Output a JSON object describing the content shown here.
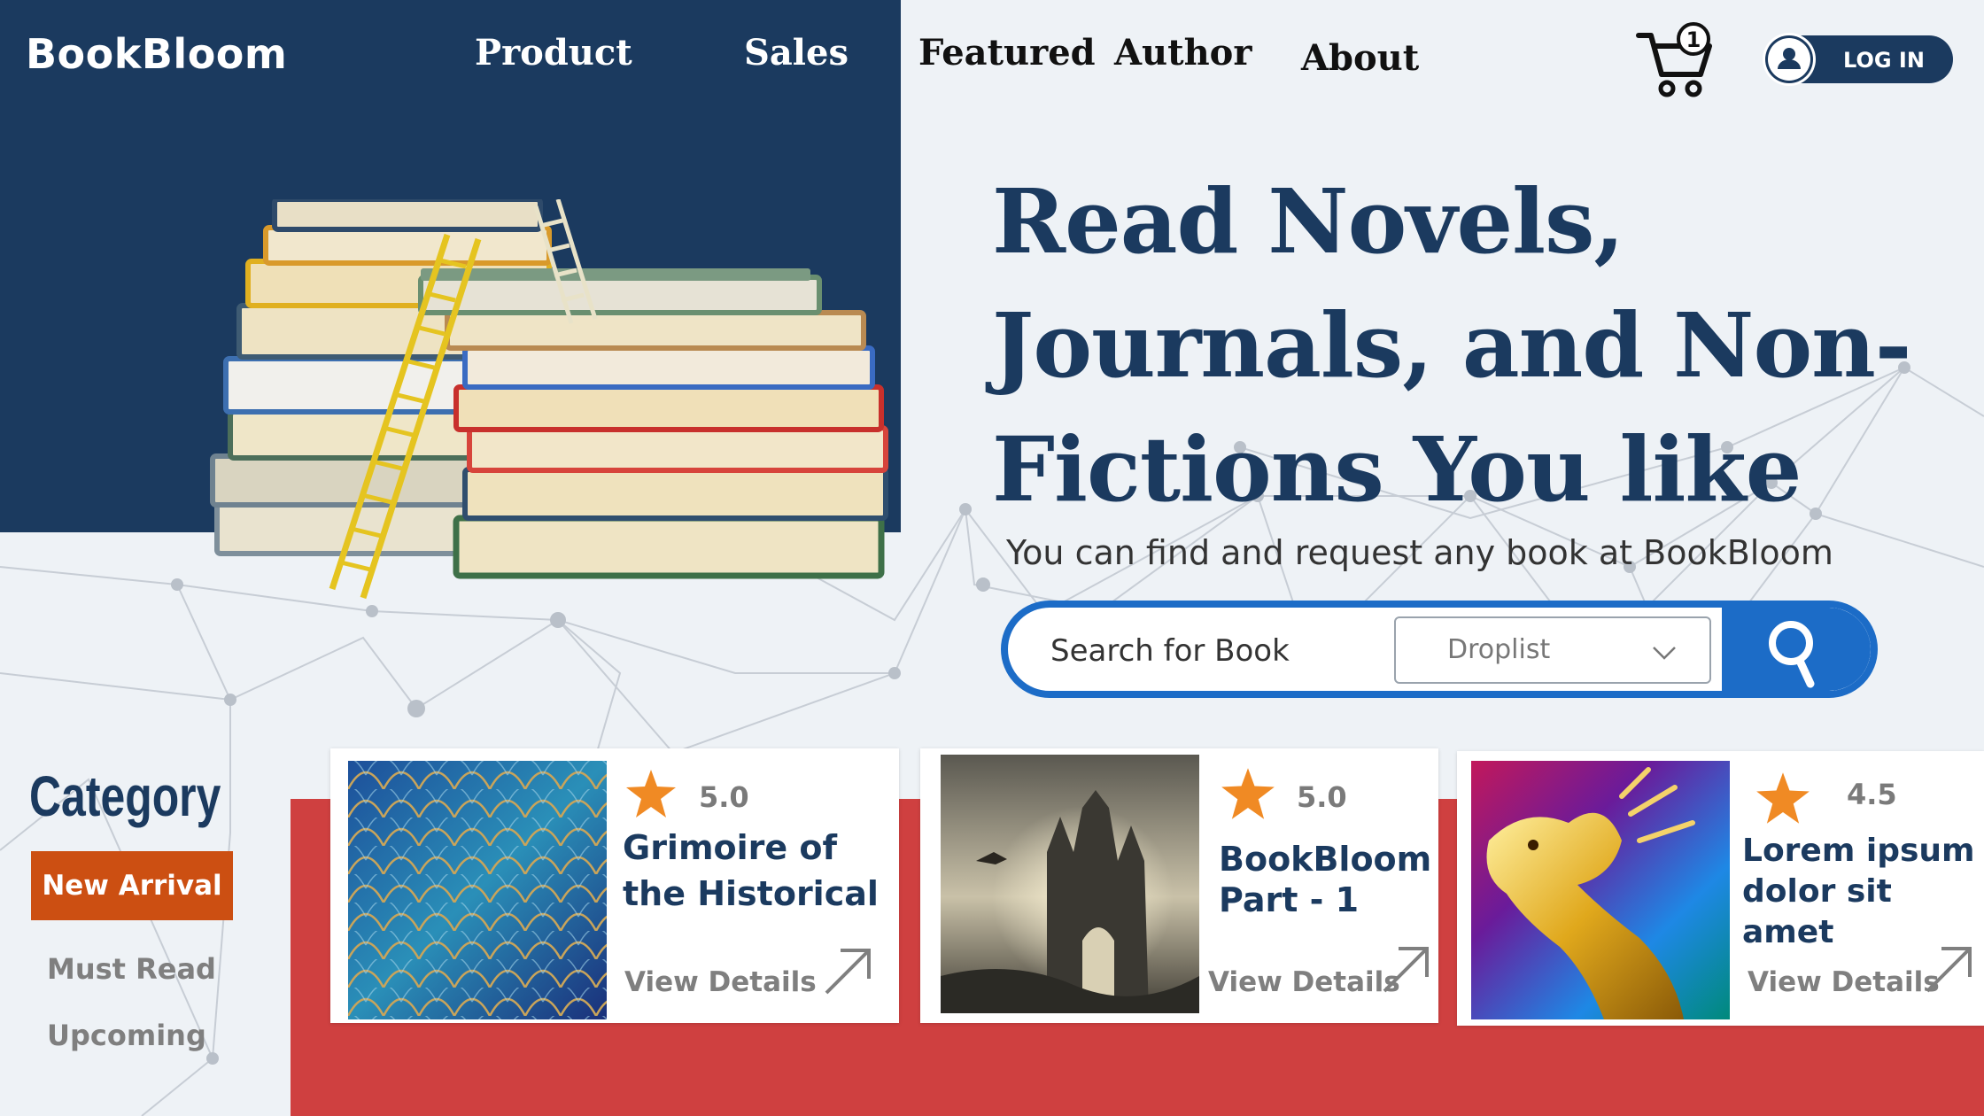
{
  "brand": {
    "name": "BookBloom"
  },
  "nav": {
    "product": "Product",
    "sales": "Sales",
    "featured": "Featured",
    "author": "Author",
    "about": "About"
  },
  "cart": {
    "count": "1",
    "icon": "cart-icon"
  },
  "login": {
    "label": "LOG IN",
    "icon": "user-icon"
  },
  "hero": {
    "headline": "Read Novels, Journals, and Non-Fictions You like",
    "tagline": "You can find and request any book at BookBloom"
  },
  "search": {
    "placeholder": "Search for Book",
    "value": "",
    "droplist_label": "Droplist",
    "button_icon": "search-icon"
  },
  "category": {
    "title": "Category",
    "items": [
      {
        "label": "New Arrival",
        "active": true
      },
      {
        "label": "Must Read",
        "active": false
      },
      {
        "label": "Upcoming",
        "active": false
      }
    ]
  },
  "books": [
    {
      "rating": "5.0",
      "title": "Grimoire of the Historical",
      "action": "View Details",
      "image": "dragon-scales"
    },
    {
      "rating": "5.0",
      "title": "BookBloom Part - 1",
      "action": "View Details",
      "image": "castle-with-dragon"
    },
    {
      "rating": "4.5",
      "title": "Lorem ipsum dolor sit amet",
      "action": "View Details",
      "image": "golden-dragon"
    }
  ],
  "colors": {
    "navy": "#1b3a5f",
    "accent_blue": "#1c6cc7",
    "orange": "#cc4f12",
    "red": "#cf4040",
    "star": "#f08a24"
  }
}
